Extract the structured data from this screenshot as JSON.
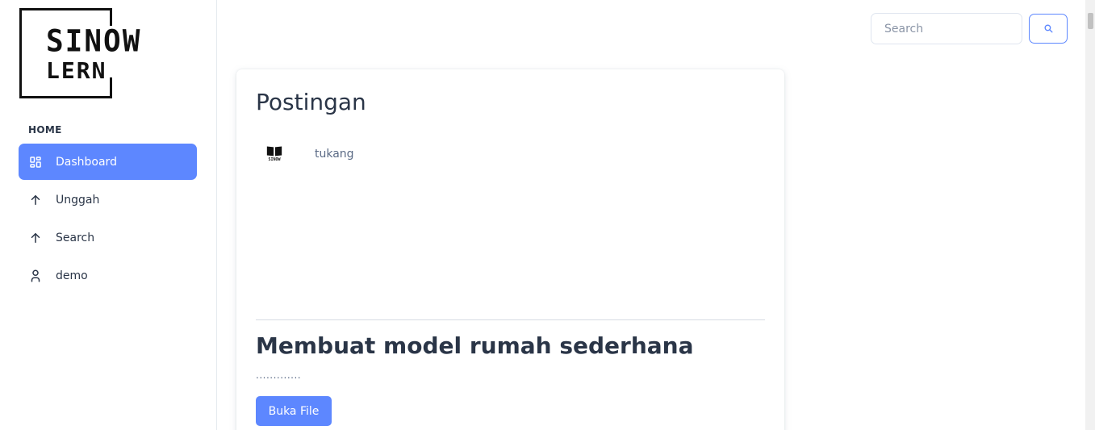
{
  "logo": {
    "line1": "SINOW",
    "line2": "LERN",
    "mini_label": "SINOW"
  },
  "sidebar": {
    "caption": "HOME",
    "items": [
      {
        "label": "Dashboard",
        "icon": "dashboard-icon",
        "active": true
      },
      {
        "label": "Unggah",
        "icon": "arrow-up-icon",
        "active": false
      },
      {
        "label": "Search",
        "icon": "arrow-up-icon",
        "active": false
      },
      {
        "label": "demo",
        "icon": "user-icon",
        "active": false
      }
    ]
  },
  "topbar": {
    "search_placeholder": "Search",
    "search_value": "",
    "search_button_icon": "search-icon"
  },
  "main": {
    "card_title": "Postingan",
    "post": {
      "author": "tukang",
      "author_icon": "book-icon",
      "title": "Membuat model rumah sederhana",
      "description": ".............",
      "button_label": "Buka File"
    }
  },
  "colors": {
    "accent": "#5d87ff",
    "text": "#2a3547",
    "muted": "#5a6a85",
    "border": "#dfe5ef"
  }
}
